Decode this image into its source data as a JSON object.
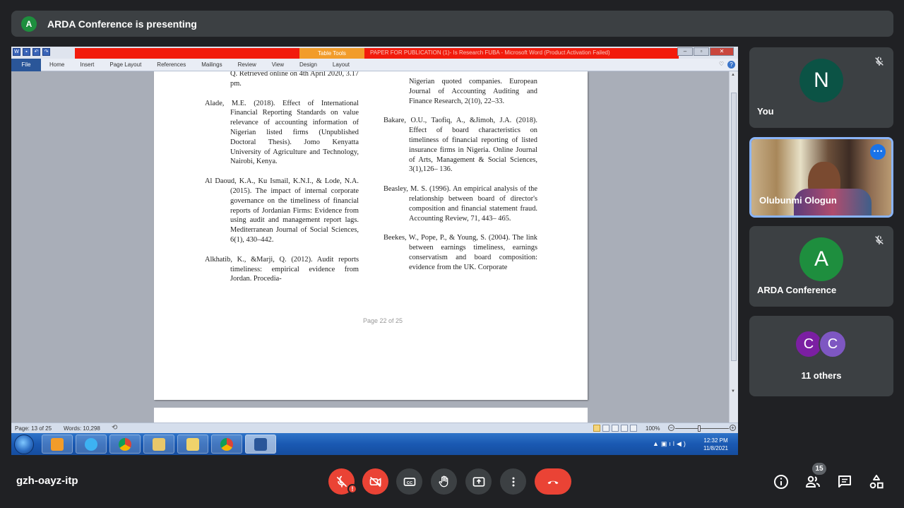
{
  "banner": {
    "avatar_letter": "A",
    "text": "ARDA Conference is presenting"
  },
  "word": {
    "contextual_tab": "Table Tools",
    "window_title": "PAPER FOR PUBLICATION (1)- Is Research FUBA - Microsoft Word (Product Activation Failed)",
    "tabs": [
      "File",
      "Home",
      "Insert",
      "Page Layout",
      "References",
      "Mailings",
      "Review",
      "View",
      "Design",
      "Layout"
    ],
    "status": {
      "page": "Page: 13 of 25",
      "words": "Words: 10,298",
      "zoom": "100%"
    },
    "page_footer": "Page 22 of 25",
    "left_column": [
      "Q. Retrieved online on 4th April 2020, 3.17 pm.",
      "Alade, M.E. (2018). Effect of International Financial Reporting Standards on value relevance of accounting information of Nigerian listed firms (Unpublished Doctoral Thesis). Jomo Kenyatta University of Agriculture and Technology, Nairobi, Kenya.",
      "Al Daoud, K.A., Ku Ismail, K.N.I., & Lode, N.A. (2015). The impact of internal corporate governance on the timeliness of financial reports of Jordanian Firms: Evidence from using audit and management report lags. Mediterranean Journal of Social Sciences, 6(1), 430–442.",
      "Alkhatib, K., &Marji, Q. (2012). Audit reports timeliness: empirical evidence from Jordan. Procedia-"
    ],
    "right_column": [
      "Nigerian quoted companies. European Journal of Accounting Auditing and Finance Research, 2(10), 22–33.",
      "Bakare, O.U., Taofiq, A., &Jimoh, J.A. (2018). Effect of board characteristics on timeliness of financial reporting of listed insurance firms in Nigeria. Online Journal of Arts, Management & Social Sciences, 3(1),126– 136.",
      "Beasley, M. S. (1996). An empirical analysis of the relationship between board of director's composition and financial statement fraud. Accounting Review, 71, 443– 465.",
      "Beekes, W., Pope, P., & Young, S. (2004). The link between earnings timeliness, earnings conservatism and board composition: evidence from the UK. Corporate"
    ]
  },
  "taskbar": {
    "time": "12:32 PM",
    "date": "11/8/2021"
  },
  "participants": [
    {
      "letter": "N",
      "name": "You",
      "color": "#0b5345"
    },
    {
      "name": "Olubunmi Ologun"
    },
    {
      "letter": "A",
      "name": "ARDA Conference",
      "color": "#1e8e3e"
    },
    {
      "letters": [
        "C",
        "C"
      ],
      "colors": [
        "#7b1fa2",
        "#7e57c2"
      ],
      "name": "11 others"
    }
  ],
  "meeting": {
    "code": "gzh-oayz-itp",
    "participant_count": "15"
  }
}
